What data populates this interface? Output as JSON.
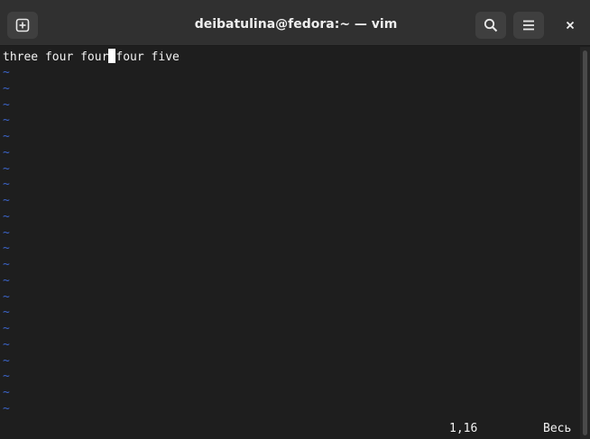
{
  "window": {
    "title": "deibatulina@fedora:~ — vim"
  },
  "headerbar": {
    "new_tab_icon": "new-tab-icon",
    "search_icon": "search-icon",
    "menu_icon": "hamburger-menu-icon",
    "close_icon": "close-icon"
  },
  "vim": {
    "line1_before_cursor": "three four four",
    "line1_after_cursor": "four five",
    "tilde": "~",
    "ruler_position": "1,16",
    "ruler_percent": "Весь"
  },
  "colors": {
    "background": "#1e1e1e",
    "headerbar": "#303030",
    "text": "#f2f2f2",
    "tilde": "#3c64c8"
  }
}
